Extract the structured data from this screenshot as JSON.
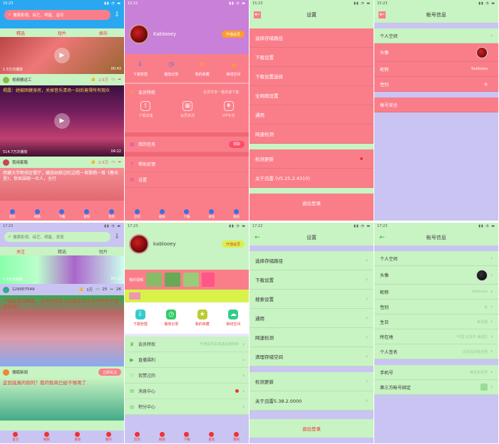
{
  "status_times": [
    "15:23",
    "15:22",
    "15:23",
    "15:23",
    "17:23",
    "17:23",
    "17:22",
    "17:23"
  ],
  "colors": {
    "pink": "#fa7e8a",
    "green": "#c8f3c3",
    "lavender": "#c9c4f2",
    "accent_orange": "#ff9c2a",
    "accent_yellow": "#d8f24a",
    "blue_strip": "#29a8f1"
  },
  "p1": {
    "search_placeholder": "搜索影视、综艺、明星、音乐",
    "tabs": [
      "精选",
      "短片",
      "娱乐"
    ],
    "videos": [
      {
        "caption": "",
        "meta_left": "1.5万次播放",
        "meta_right": "00:43",
        "author": "视频搬运工",
        "likes": "2.5万",
        "comments": ""
      },
      {
        "caption": "揭露：她被困健身房，关掉音乐清场一刻后竟得所有观众",
        "meta_left": "514.7万次播放",
        "meta_right": "04:22",
        "author": "我用套路",
        "likes": "2.5万",
        "comments": ""
      },
      {
        "caption": "西藏大学新校区餐厅，藏族姑娘边吃边唱一首歌唱一首《春天里》，惊呆围观一众人，全打",
        "meta_left": "",
        "meta_right": "",
        "author": "",
        "likes": "",
        "comments": ""
      }
    ],
    "tabbar": [
      "首页",
      "视频",
      "下载",
      "发现",
      "我的"
    ]
  },
  "p2": {
    "username": "Kablooey",
    "subtitle": "",
    "vip_chip": "开通会员",
    "quick": [
      "下载管理",
      "播放记录",
      "我的收藏",
      "离线空间"
    ],
    "vip_title": "会员特权",
    "vip_sub": "会员专享一键高速下载",
    "vip_icons": [
      "下载加速",
      "会员高清",
      "VIP专享"
    ],
    "menu": [
      "我的任务",
      "帮助反馈",
      "设置"
    ],
    "task_badge": "领取",
    "tabbar": [
      "首页",
      "视频",
      "下载",
      "发现",
      "我的"
    ]
  },
  "p3": {
    "title": "设置",
    "rows_a": [
      "选择存储路径",
      "下载设置",
      "下载设置选择",
      "全网搜设置",
      "通用",
      "网速检测"
    ],
    "rows_b": [
      "检测更新",
      "关于迅雷 (V5.25.2.4310)"
    ],
    "logout": "退出登录"
  },
  "p4": {
    "title": "帐号信息",
    "rows_a": [
      {
        "label": "个人空间",
        "value": ""
      },
      {
        "label": "头像",
        "value": ""
      },
      {
        "label": "昵称",
        "value": "Kablooey"
      },
      {
        "label": "性别",
        "value": "女"
      }
    ],
    "rows_b": [
      {
        "label": "帐号安全",
        "value": ""
      }
    ]
  },
  "p5": {
    "search_placeholder": "搜索影视、综艺、明星、发现",
    "tabs": [
      "关注",
      "精选",
      "短片"
    ],
    "videos": [
      {
        "caption": "",
        "meta_left": "1.5万次观看",
        "meta_right": "00:11",
        "author": "129007549",
        "likes": "1万",
        "comments": "25",
        "shares": "26"
      },
      {
        "caption": "一拍抖音的网友，古代时候穿上古装有女士生中的样子是怎么的？",
        "meta_left": "",
        "meta_right": "",
        "author": "搜狐新闻",
        "likes": "",
        "comments": "",
        "follow": "立即关注"
      },
      {
        "caption": "这到底真的假的？我的智商已经不够用了",
        "meta_left": "",
        "meta_right": "",
        "author": "",
        "likes": ""
      }
    ],
    "tabbar": [
      "首页",
      "视频",
      "发现",
      "我的"
    ]
  },
  "p6": {
    "username": "kablooey",
    "subtitle": "",
    "vip_chip": "开通会员",
    "shelf_label": "我的视频",
    "quick": [
      "下载管理",
      "播放记录",
      "我的收藏",
      "离线空间"
    ],
    "menu": [
      "会员特权",
      "直播福利",
      "我赞过的",
      "消息中心",
      "积分中心"
    ],
    "vip_sub": "开通会员享高速加速特权",
    "tabbar": [
      "首页",
      "视频",
      "下载",
      "发现",
      "我的"
    ]
  },
  "p7": {
    "title": "设置",
    "rows_a": [
      "选择存储路径",
      "下载设置",
      "搜索设置",
      "通用",
      "网速检测",
      "清理存储空间"
    ],
    "rows_b": [
      "检测更新",
      "关于迅雷5.38.2.0000"
    ],
    "logout": "退出登录"
  },
  "p8": {
    "title": "帐号信息",
    "rows_a": [
      {
        "label": "个人空间",
        "value": ""
      },
      {
        "label": "头像",
        "value": ""
      },
      {
        "label": "昵称",
        "value": "kablooey"
      },
      {
        "label": "性别",
        "value": "女"
      },
      {
        "label": "生日",
        "value": "未设置"
      },
      {
        "label": "所在地",
        "value": "中国 北京市 海淀区"
      },
      {
        "label": "个人签名",
        "value": "还没写好签名哦"
      }
    ],
    "rows_b": [
      {
        "label": "手机号",
        "value": "绑定手机号"
      },
      {
        "label": "第三方帐号绑定",
        "value": ""
      }
    ]
  }
}
